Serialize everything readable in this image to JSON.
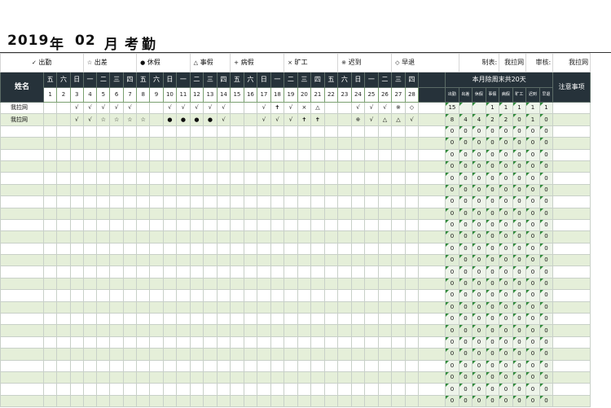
{
  "title": {
    "year": "2019",
    "year_unit": "年",
    "month": "02",
    "month_unit": "月",
    "label": "考勤"
  },
  "legend": [
    {
      "sym": "✓",
      "text": "出勤"
    },
    {
      "sym": "☆",
      "text": "出差"
    },
    {
      "sym": "●",
      "text": "休假"
    },
    {
      "sym": "△",
      "text": "事假"
    },
    {
      "sym": "+",
      "text": "病假"
    },
    {
      "sym": "×",
      "text": "旷工"
    },
    {
      "sym": "※",
      "text": "迟到"
    },
    {
      "sym": "◇",
      "text": "早退"
    }
  ],
  "meta": {
    "maker_label": "制表:",
    "maker": "我拉网",
    "reviewer_label": "审核:",
    "reviewer": "我拉网"
  },
  "header": {
    "name": "姓名",
    "summary_title": "本月除周末共20天",
    "notes": "注意事项",
    "weekdays": [
      "五",
      "六",
      "日",
      "一",
      "二",
      "三",
      "四",
      "五",
      "六",
      "日",
      "一",
      "二",
      "三",
      "四",
      "五",
      "六",
      "日",
      "一",
      "二",
      "三",
      "四",
      "五",
      "六",
      "日",
      "一",
      "二",
      "三",
      "四"
    ],
    "days": [
      "1",
      "2",
      "3",
      "4",
      "5",
      "6",
      "7",
      "8",
      "9",
      "10",
      "11",
      "12",
      "13",
      "14",
      "15",
      "16",
      "17",
      "18",
      "19",
      "20",
      "21",
      "22",
      "23",
      "24",
      "25",
      "26",
      "27",
      "28"
    ],
    "summary_cols": [
      "出勤",
      "出差",
      "休假",
      "事假",
      "病假",
      "旷工",
      "迟到",
      "早退"
    ]
  },
  "rows": [
    {
      "name": "我拉网",
      "marks": [
        "",
        "",
        "√",
        "√",
        "√",
        "√",
        "√",
        "",
        "",
        "√",
        "√",
        "√",
        "√",
        "√",
        "",
        "",
        "√",
        "✝",
        "√",
        "×",
        "△",
        "",
        "",
        "√",
        "√",
        "√",
        "※",
        "◇"
      ],
      "summary": [
        "15",
        "",
        "",
        "1",
        "1",
        "1",
        "1",
        "1"
      ]
    },
    {
      "name": "我拉网",
      "marks": [
        "",
        "",
        "√",
        "√",
        "☆",
        "☆",
        "☆",
        "☆",
        "",
        "●",
        "●",
        "●",
        "●",
        "√",
        "",
        "",
        "√",
        "√",
        "√",
        "✝",
        "✝",
        "",
        "",
        "※",
        "√",
        "△",
        "△",
        "√"
      ],
      "summary": [
        "8",
        "4",
        "4",
        "2",
        "2",
        "0",
        "1",
        "0"
      ]
    }
  ],
  "empty_rows": 24,
  "empty_summary_value": "0",
  "colors": {
    "header_bg": "#26323a",
    "band_green": "#e5efd9",
    "marker_green": "#2f8a3a"
  }
}
